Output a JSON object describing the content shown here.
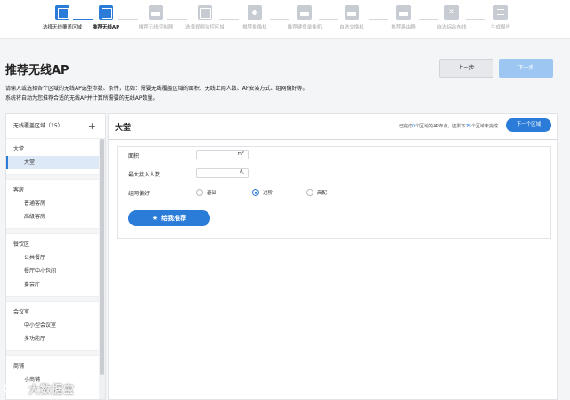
{
  "steps": [
    {
      "label": "选择无线覆盖区域",
      "state": "done",
      "icon": "map-icon"
    },
    {
      "label": "推荐无线AP",
      "state": "active",
      "icon": "ap-icon"
    },
    {
      "label": "推荐无线控制器",
      "state": "todo",
      "icon": "controller-icon"
    },
    {
      "label": "选择视频监控区域",
      "state": "todo",
      "icon": "video-area-icon"
    },
    {
      "label": "推荐摄像机",
      "state": "todo",
      "icon": "camera-icon"
    },
    {
      "label": "推荐硬盘录像机",
      "state": "todo",
      "icon": "nvr-icon"
    },
    {
      "label": "自选交换机",
      "state": "todo",
      "icon": "switch-icon"
    },
    {
      "label": "推荐路由器",
      "state": "todo",
      "icon": "router-icon"
    },
    {
      "label": "自选综合布线",
      "state": "todo",
      "icon": "cabling-icon"
    },
    {
      "label": "生成报告",
      "state": "todo",
      "icon": "report-icon"
    }
  ],
  "header": {
    "title": "推荐无线AP",
    "desc1": "请输入或选择各个区域的无线AP选型参数、条件，比如：需要无线覆盖区域的面积、无线上网人数、AP安装方式、组网偏好等。",
    "desc2": "系统将自动为您推荐合适的无线AP并计算所需要的无线AP数量。",
    "prev_label": "上一步",
    "next_label": "下一步"
  },
  "sidebar": {
    "title": "无线覆盖区域（15）",
    "add_symbol": "+",
    "groups": [
      {
        "title": "大堂",
        "items": [
          "大堂"
        ]
      },
      {
        "title": "客房",
        "items": [
          "普通客房",
          "高级客房"
        ]
      },
      {
        "title": "餐饮区",
        "items": [
          "公共餐厅",
          "餐厅中小包间",
          "宴会厅"
        ]
      },
      {
        "title": "会议室",
        "items": [
          "中小型会议室",
          "多功能厅"
        ]
      },
      {
        "title": "商铺",
        "items": [
          "小商铺"
        ]
      }
    ],
    "selected_item": "大堂"
  },
  "area": {
    "title": "大堂",
    "progress_prefix": "已完成",
    "completed_count": "0",
    "progress_middle": "个区域的AP布点，还剩下",
    "remaining_count": "15",
    "progress_suffix": "个区域未完成",
    "next_area_label": "下一个区域"
  },
  "form": {
    "area_label": "面积",
    "area_unit": "m²",
    "area_value": "",
    "max_users_label": "最大接入人数",
    "max_users_unit": "人",
    "max_users_value": "",
    "preference_label": "组网偏好",
    "preference_options": [
      "基础",
      "进阶",
      "高配"
    ],
    "preference_selected": "进阶",
    "recommend_label": "给我推荐",
    "recommend_icon": "star-icon"
  },
  "watermark": {
    "text": "大数据宝"
  },
  "colors": {
    "accent": "#2b7bd8",
    "accent_light": "#9dc6f2",
    "selected_bg": "#dde9f7"
  }
}
